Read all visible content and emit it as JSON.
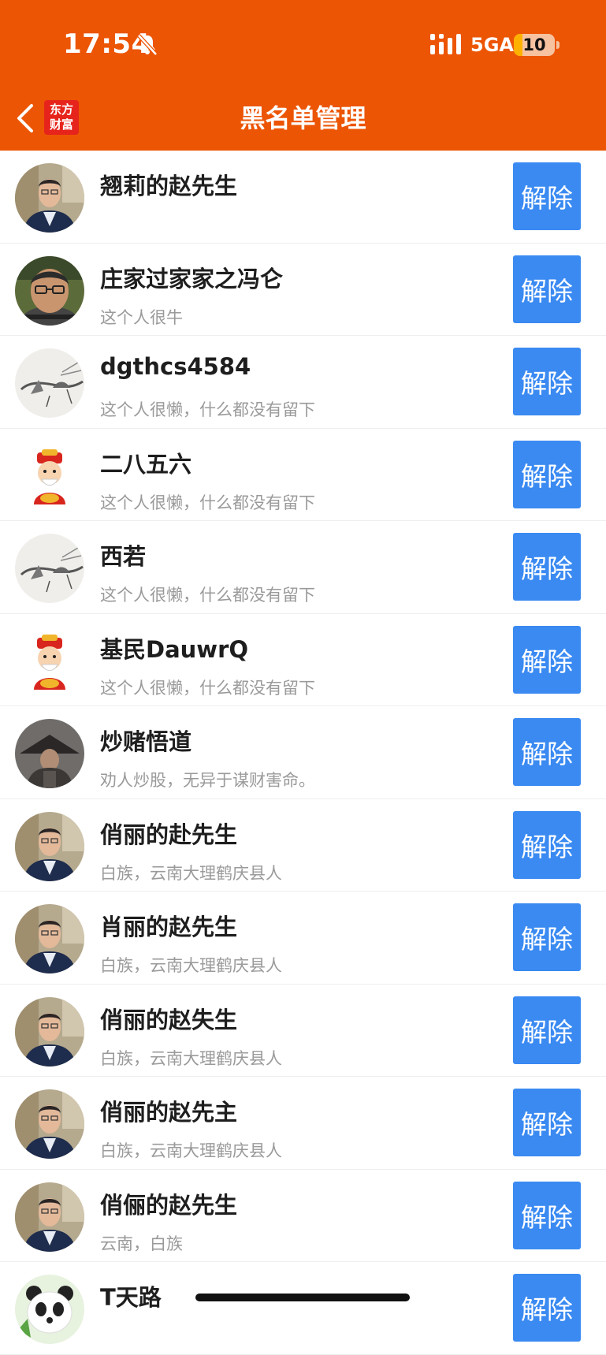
{
  "status_bar": {
    "time": "17:54",
    "network": "5GA",
    "battery": "10",
    "battery_level": 0.1
  },
  "nav": {
    "title": "黑名单管理",
    "logo_line1": "东方",
    "logo_line2": "财富"
  },
  "action_label": "解除",
  "rows": [
    {
      "name": "翘莉的赵先生",
      "signature": "",
      "avatar": "portrait"
    },
    {
      "name": "庄家过家家之冯仑",
      "signature": "这个人很牛",
      "avatar": "man-glasses"
    },
    {
      "name": "dgthcs4584",
      "signature": "这个人很懒，什么都没有留下",
      "avatar": "ink-painting"
    },
    {
      "name": "二八五六",
      "signature": "这个人很懒，什么都没有留下",
      "avatar": "fortune-god"
    },
    {
      "name": "西若",
      "signature": "这个人很懒，什么都没有留下",
      "avatar": "ink-painting"
    },
    {
      "name": "基民DauwrQ",
      "signature": "这个人很懒，什么都没有留下",
      "avatar": "fortune-god"
    },
    {
      "name": "炒赌悟道",
      "signature": "劝人炒股，无异于谋财害命。",
      "avatar": "warrior"
    },
    {
      "name": "俏丽的赴先生",
      "signature": "白族，云南大理鹤庆县人",
      "avatar": "portrait"
    },
    {
      "name": "肖丽的赵先生",
      "signature": "白族，云南大理鹤庆县人",
      "avatar": "portrait"
    },
    {
      "name": "俏丽的赵失生",
      "signature": "白族，云南大理鹤庆县人",
      "avatar": "portrait"
    },
    {
      "name": "俏丽的赵先主",
      "signature": "白族，云南大理鹤庆县人",
      "avatar": "portrait"
    },
    {
      "name": "俏俪的赵先生",
      "signature": "云南，白族",
      "avatar": "portrait"
    },
    {
      "name": "T天路",
      "signature": "",
      "avatar": "panda"
    }
  ]
}
